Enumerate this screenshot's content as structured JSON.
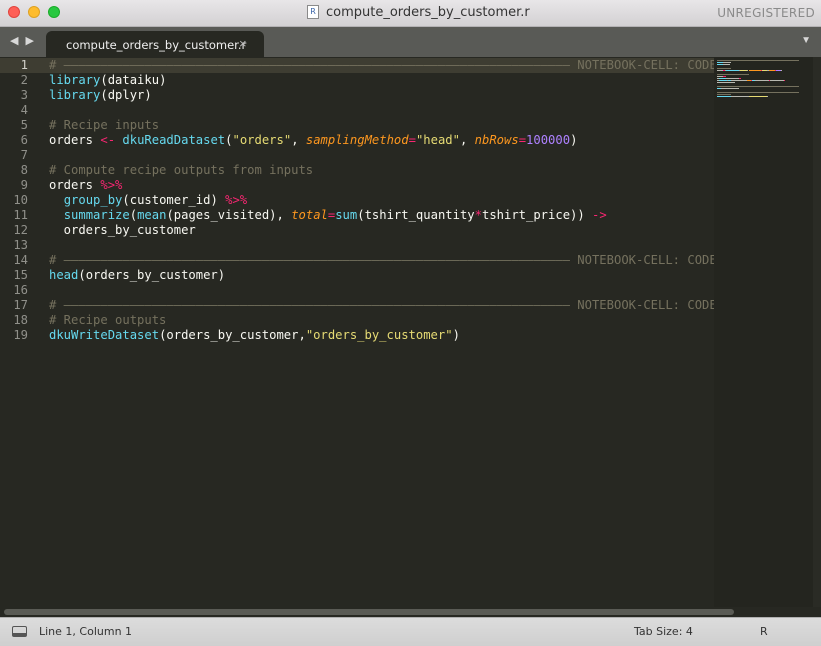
{
  "window": {
    "title": "compute_orders_by_customer.r",
    "doc_icon": "R",
    "license_status": "UNREGISTERED"
  },
  "tabs": [
    {
      "label": "compute_orders_by_customer.r",
      "close": "×"
    }
  ],
  "nav": {
    "arrows": "◀ ▶",
    "menu": "▼"
  },
  "editor": {
    "line_numbers": [
      "1",
      "2",
      "3",
      "4",
      "5",
      "6",
      "7",
      "8",
      "9",
      "10",
      "11",
      "12",
      "13",
      "14",
      "15",
      "16",
      "17",
      "18",
      "19"
    ],
    "lines": [
      [
        {
          "t": "# ————————————————————————————————————————————————————————————————————— NOTEBOOK-CELL: CODE",
          "c": "cm"
        }
      ],
      [
        {
          "t": "library",
          "c": "fn"
        },
        {
          "t": "(dataiku)",
          "c": "pl"
        }
      ],
      [
        {
          "t": "library",
          "c": "fn"
        },
        {
          "t": "(dplyr)",
          "c": "pl"
        }
      ],
      [],
      [
        {
          "t": "# Recipe inputs",
          "c": "cm"
        }
      ],
      [
        {
          "t": "orders ",
          "c": "pl"
        },
        {
          "t": "<-",
          "c": "op"
        },
        {
          "t": " ",
          "c": "pl"
        },
        {
          "t": "dkuReadDataset",
          "c": "fn"
        },
        {
          "t": "(",
          "c": "pl"
        },
        {
          "t": "\"orders\"",
          "c": "str"
        },
        {
          "t": ", ",
          "c": "pl"
        },
        {
          "t": "samplingMethod",
          "c": "arg"
        },
        {
          "t": "=",
          "c": "op"
        },
        {
          "t": "\"head\"",
          "c": "str"
        },
        {
          "t": ", ",
          "c": "pl"
        },
        {
          "t": "nbRows",
          "c": "arg"
        },
        {
          "t": "=",
          "c": "op"
        },
        {
          "t": "100000",
          "c": "num"
        },
        {
          "t": ")",
          "c": "pl"
        }
      ],
      [],
      [
        {
          "t": "# Compute recipe outputs from inputs",
          "c": "cm"
        }
      ],
      [
        {
          "t": "orders ",
          "c": "pl"
        },
        {
          "t": "%>%",
          "c": "op"
        }
      ],
      [
        {
          "t": "  ",
          "c": "pl"
        },
        {
          "t": "group_by",
          "c": "fn"
        },
        {
          "t": "(customer_id) ",
          "c": "pl"
        },
        {
          "t": "%>%",
          "c": "op"
        }
      ],
      [
        {
          "t": "  ",
          "c": "pl"
        },
        {
          "t": "summarize",
          "c": "fn"
        },
        {
          "t": "(",
          "c": "pl"
        },
        {
          "t": "mean",
          "c": "fn"
        },
        {
          "t": "(pages_visited), ",
          "c": "pl"
        },
        {
          "t": "total",
          "c": "arg"
        },
        {
          "t": "=",
          "c": "op"
        },
        {
          "t": "sum",
          "c": "fn"
        },
        {
          "t": "(tshirt_quantity",
          "c": "pl"
        },
        {
          "t": "*",
          "c": "op"
        },
        {
          "t": "tshirt_price)) ",
          "c": "pl"
        },
        {
          "t": "->",
          "c": "op"
        }
      ],
      [
        {
          "t": "  orders_by_customer",
          "c": "pl"
        }
      ],
      [],
      [
        {
          "t": "# ————————————————————————————————————————————————————————————————————— NOTEBOOK-CELL: CODE",
          "c": "cm"
        }
      ],
      [
        {
          "t": "head",
          "c": "fn"
        },
        {
          "t": "(orders_by_customer)",
          "c": "pl"
        }
      ],
      [],
      [
        {
          "t": "# ————————————————————————————————————————————————————————————————————— NOTEBOOK-CELL: CODE",
          "c": "cm"
        }
      ],
      [
        {
          "t": "# Recipe outputs",
          "c": "cm"
        }
      ],
      [
        {
          "t": "dkuWriteDataset",
          "c": "fn"
        },
        {
          "t": "(orders_by_customer,",
          "c": "pl"
        },
        {
          "t": "\"orders_by_customer\"",
          "c": "str"
        },
        {
          "t": ")",
          "c": "pl"
        }
      ]
    ]
  },
  "status": {
    "position": "Line 1, Column 1",
    "tab_size": "Tab Size: 4",
    "syntax": "R"
  },
  "colors": {
    "background": "#272822",
    "comment": "#75715e",
    "function": "#66d9ef",
    "string": "#e6db74",
    "operator": "#f92672",
    "number": "#ae81ff",
    "argument": "#fd971f"
  }
}
